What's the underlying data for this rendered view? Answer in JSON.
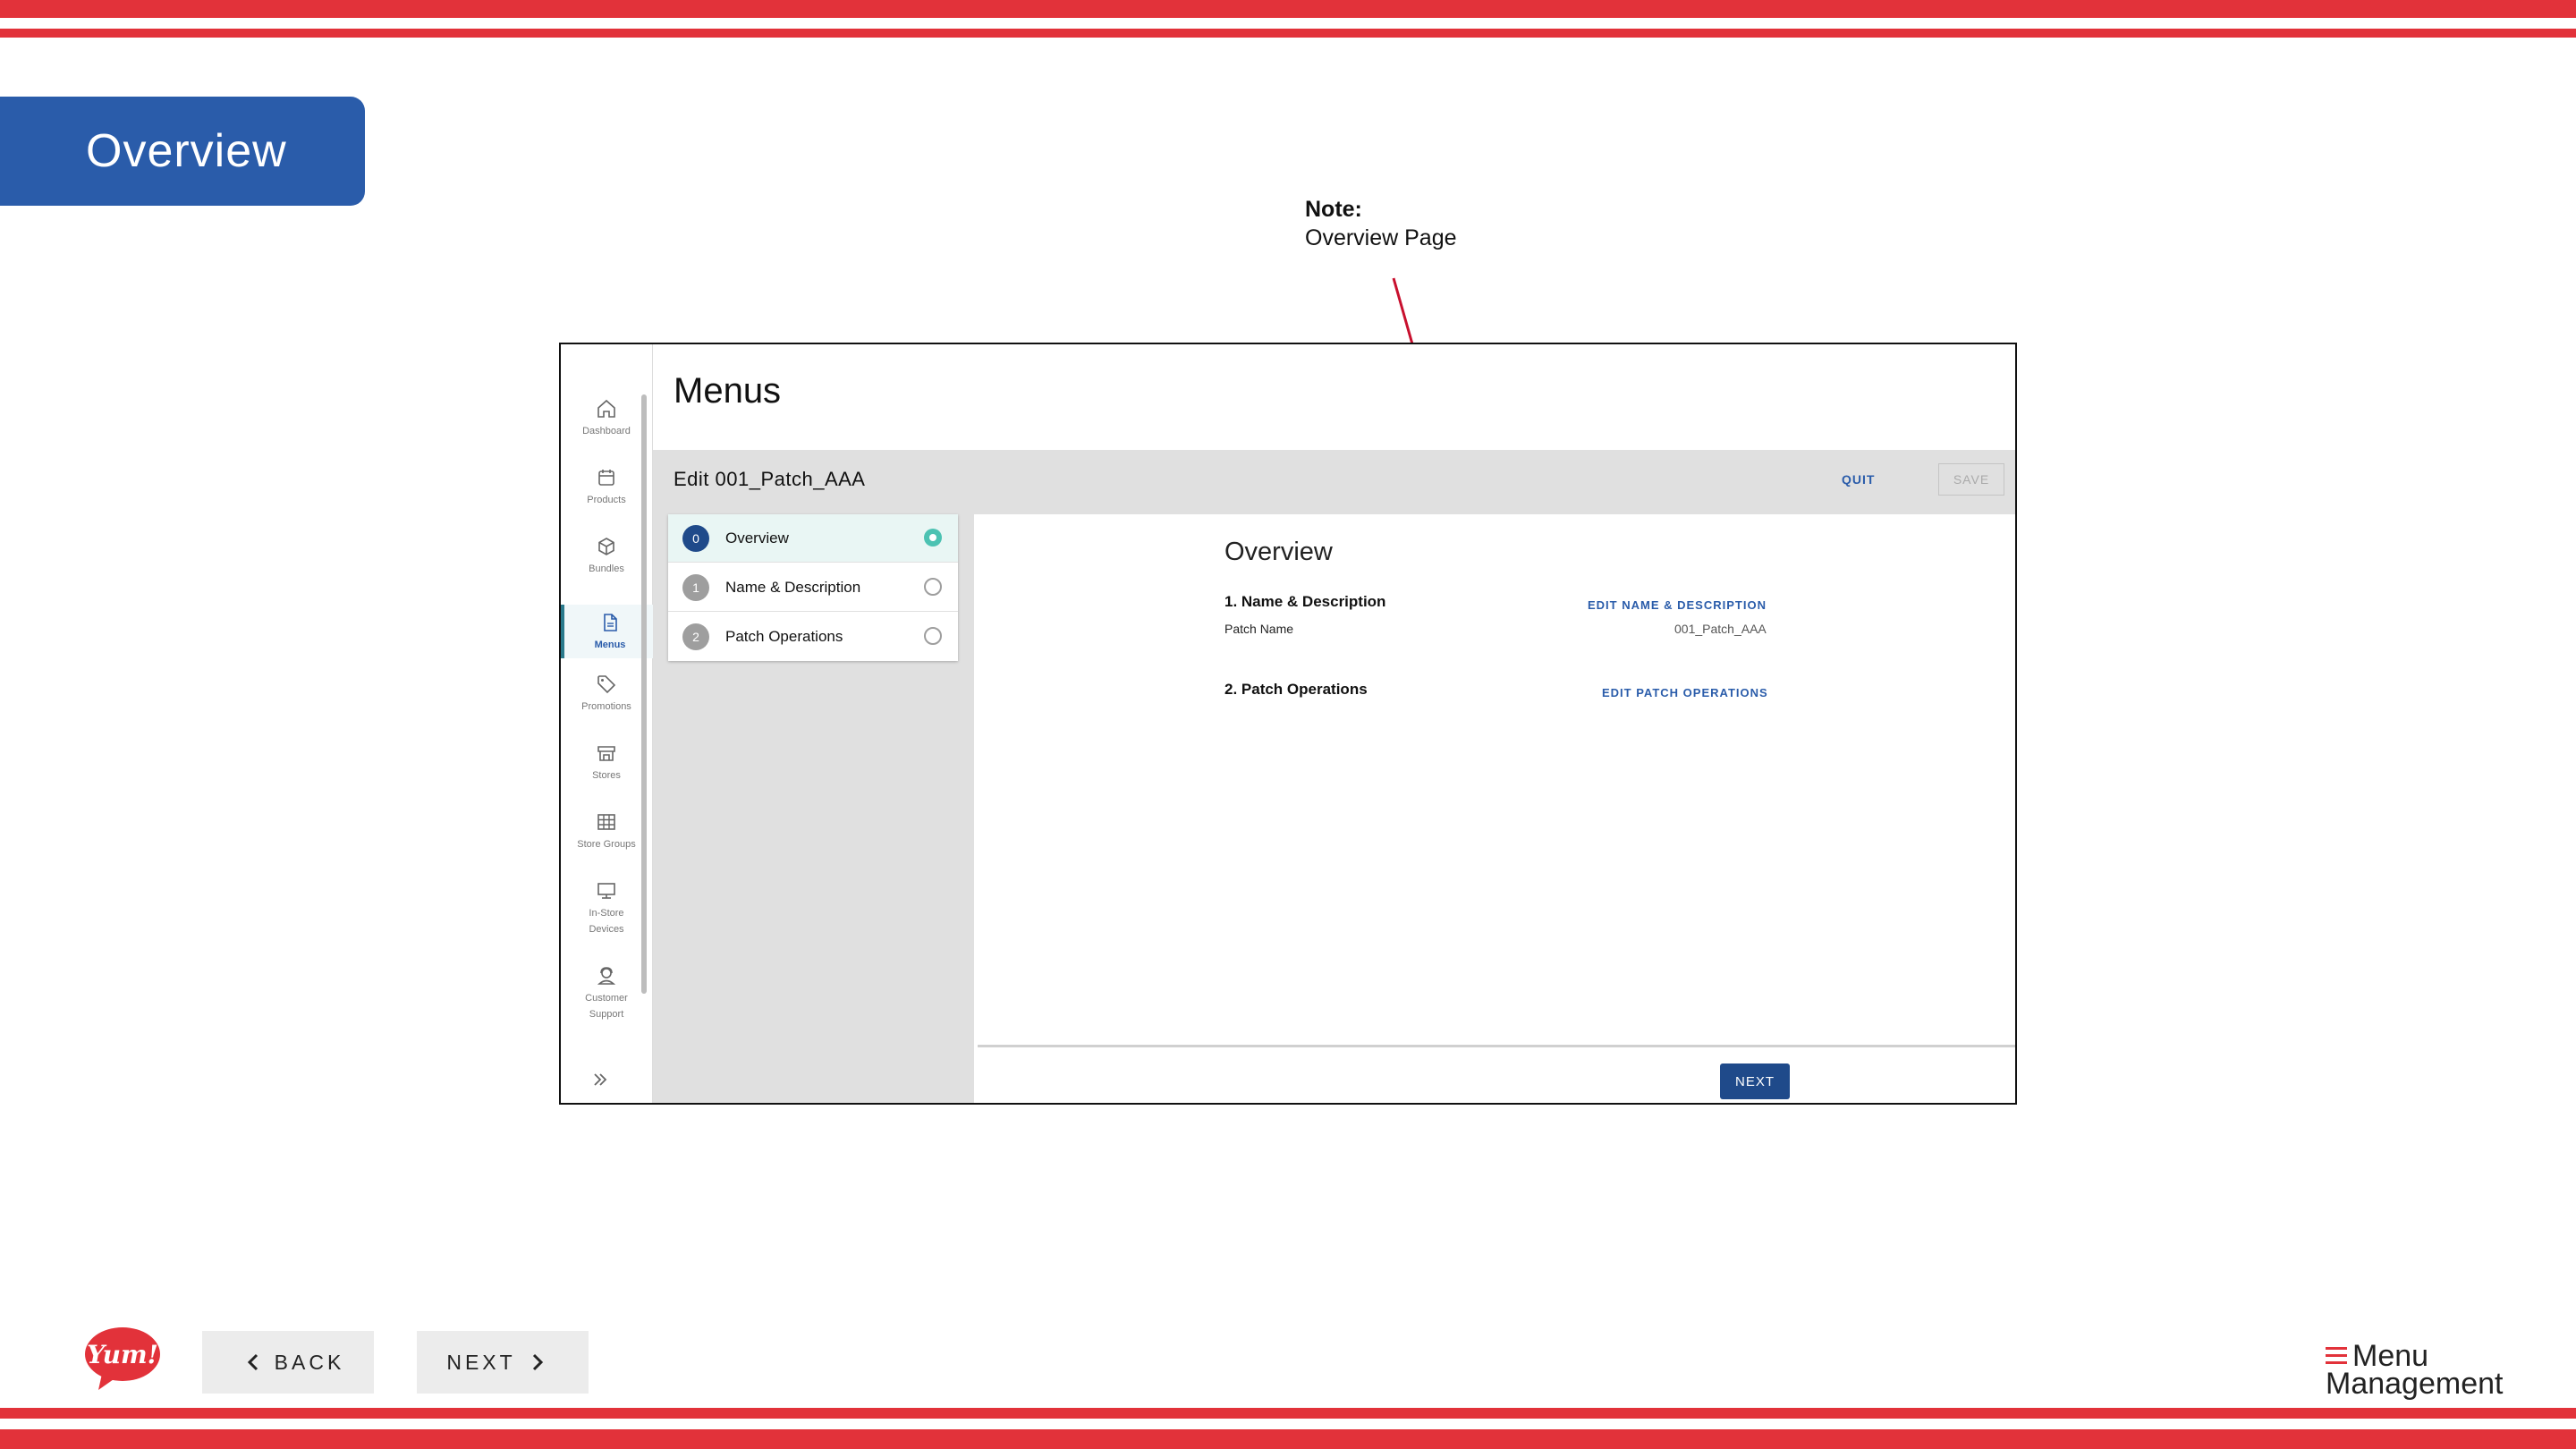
{
  "slide": {
    "title": "Overview",
    "note_title": "Note:",
    "note_body": "Overview Page",
    "colors": {
      "stripe": "#e2323a",
      "title_tab": "#2a5caa",
      "accent_link": "#2a5caa",
      "active_step": "#4cc2b2"
    }
  },
  "app": {
    "page_title": "Menus",
    "edit_title": "Edit 001_Patch_AAA",
    "quit_label": "QUIT",
    "save_label": "SAVE",
    "sidebar": {
      "items": [
        {
          "label": "Dashboard",
          "icon": "home-icon"
        },
        {
          "label": "Products",
          "icon": "calendar-icon"
        },
        {
          "label": "Bundles",
          "icon": "cube-icon"
        },
        {
          "label": "Menus",
          "icon": "document-icon",
          "active": true
        },
        {
          "label": "Promotions",
          "icon": "tag-icon"
        },
        {
          "label": "Stores",
          "icon": "store-icon"
        },
        {
          "label": "Store Groups",
          "icon": "grid-icon"
        },
        {
          "label_line1": "In-Store",
          "label_line2": "Devices",
          "icon": "monitor-icon"
        },
        {
          "label_line1": "Customer",
          "label_line2": "Support",
          "icon": "support-icon"
        }
      ],
      "expand_icon": "double-chevron-right-icon"
    },
    "steps": [
      {
        "num": "0",
        "label": "Overview",
        "active": true
      },
      {
        "num": "1",
        "label": "Name & Description",
        "active": false
      },
      {
        "num": "2",
        "label": "Patch Operations",
        "active": false
      }
    ],
    "content": {
      "heading": "Overview",
      "section1_title": "1. Name & Description",
      "section1_link": "EDIT NAME & DESCRIPTION",
      "patch_name_label": "Patch Name",
      "patch_name_value": "001_Patch_AAA",
      "section2_title": "2. Patch Operations",
      "section2_link": "EDIT PATCH OPERATIONS",
      "next_label": "NEXT"
    }
  },
  "footer": {
    "yum_logo_text": "Yum!",
    "back_label": "BACK",
    "next_label": "NEXT",
    "brand_line1": "Menu",
    "brand_line2": "Management"
  }
}
